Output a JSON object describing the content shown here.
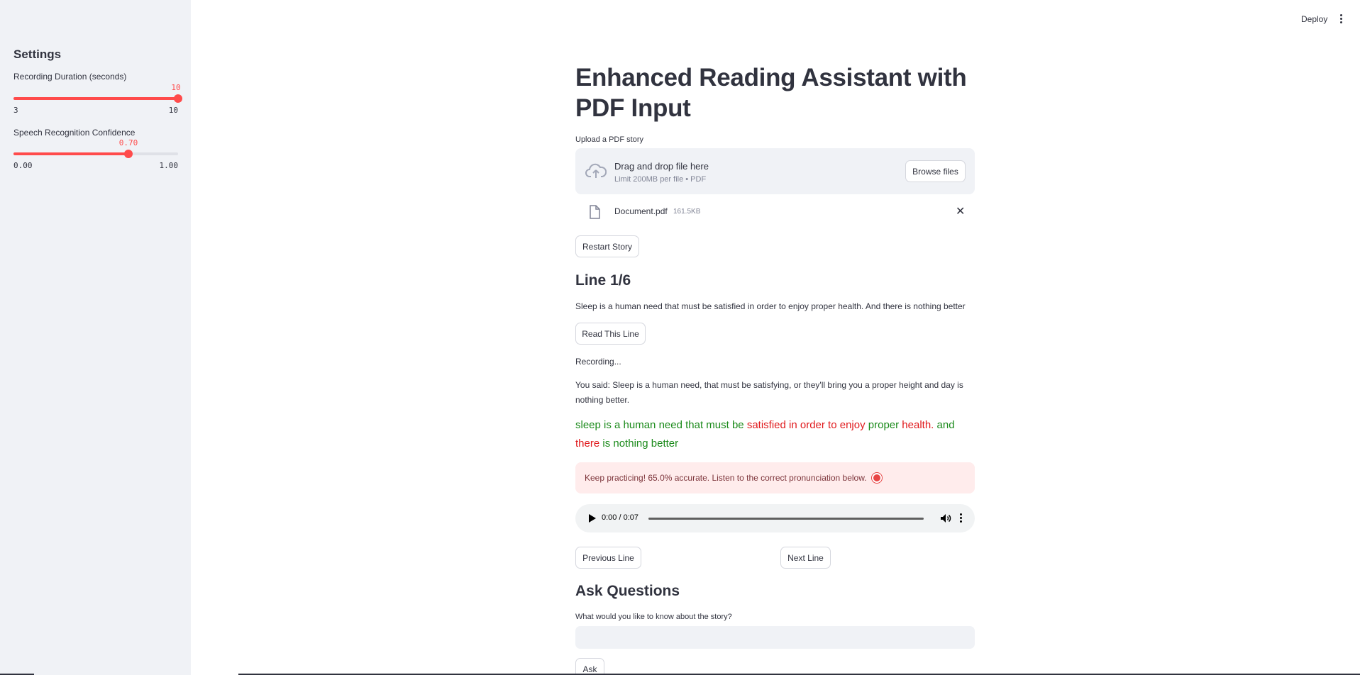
{
  "sidebar": {
    "title": "Settings",
    "sliders": [
      {
        "label": "Recording Duration (seconds)",
        "value": "10",
        "min": "3",
        "max": "10",
        "fraction": 1.0
      },
      {
        "label": "Speech Recognition Confidence",
        "value": "0.70",
        "min": "0.00",
        "max": "1.00",
        "fraction": 0.7
      }
    ]
  },
  "header": {
    "deploy_label": "Deploy",
    "menu_icon": "kebab-menu-icon"
  },
  "main": {
    "title": "Enhanced Reading Assistant with PDF Input",
    "upload": {
      "label": "Upload a PDF story",
      "drag_text": "Drag and drop file here",
      "limit_text": "Limit 200MB per file • PDF",
      "browse_label": "Browse files",
      "file_name": "Document.pdf",
      "file_size": "161.5KB"
    },
    "restart_label": "Restart Story",
    "line_heading": "Line 1/6",
    "line_text": "Sleep is a human need that must be satisfied in order to enjoy proper health. And there is nothing better",
    "read_line_label": "Read This Line",
    "recording_text": "Recording...",
    "you_said": "You said: Sleep is a human need, that must be satisfying, or they'll bring you a proper height and day is nothing better.",
    "comparison": [
      {
        "text": "sleep is a human need that must be",
        "status": "correct"
      },
      {
        "text": "satisfied in order to enjoy",
        "status": "wrong"
      },
      {
        "text": "proper",
        "status": "correct"
      },
      {
        "text": "health.",
        "status": "wrong"
      },
      {
        "text": "and",
        "status": "correct"
      },
      {
        "text": "there",
        "status": "wrong"
      },
      {
        "text": "is nothing better",
        "status": "correct"
      }
    ],
    "feedback": "Keep practicing! 65.0% accurate. Listen to the correct pronunciation below.",
    "audio": {
      "time": "0:00 / 0:07"
    },
    "prev_label": "Previous Line",
    "next_label": "Next Line",
    "questions_heading": "Ask Questions",
    "question_label": "What would you like to know about the story?",
    "question_value": "",
    "ask_label": "Ask"
  },
  "colors": {
    "accent": "#ff4b4b",
    "correct": "#1a8a1a",
    "wrong": "#e0191c",
    "sidebar_bg": "#f0f2f6",
    "alert_bg": "#ffecec"
  }
}
